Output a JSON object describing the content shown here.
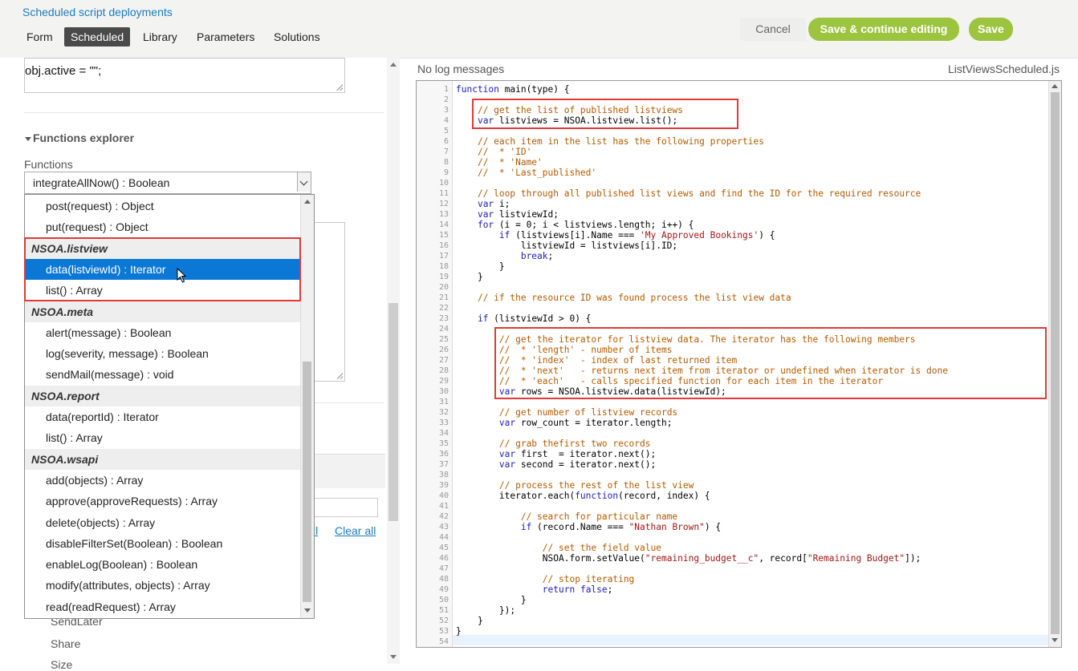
{
  "header": {
    "breadcrumb": "Scheduled script deployments",
    "tabs": [
      "Form",
      "Scheduled",
      "Library",
      "Parameters",
      "Solutions"
    ],
    "active_tab": "Scheduled",
    "cancel_label": "Cancel",
    "save_continue_label": "Save & continue editing",
    "save_label": "Save",
    "accent_color": "#9cc43f"
  },
  "left": {
    "code_snippet": "obj.active = \"\";",
    "functions_explorer_title": "Functions explorer",
    "functions_label": "Functions",
    "selected_function": "integrateAllNow() : Boolean",
    "dropdown": [
      {
        "type": "item",
        "label": "post(request) : Object"
      },
      {
        "type": "item",
        "label": "put(request) : Object"
      },
      {
        "type": "group",
        "label": "NSOA.listview"
      },
      {
        "type": "item",
        "label": "data(listviewId) : Iterator",
        "selected": true
      },
      {
        "type": "item",
        "label": "list() : Array"
      },
      {
        "type": "group",
        "label": "NSOA.meta"
      },
      {
        "type": "item",
        "label": "alert(message) : Boolean"
      },
      {
        "type": "item",
        "label": "log(severity, message) : Boolean"
      },
      {
        "type": "item",
        "label": "sendMail(message) : void"
      },
      {
        "type": "group",
        "label": "NSOA.report"
      },
      {
        "type": "item",
        "label": "data(reportId) : Iterator"
      },
      {
        "type": "item",
        "label": "list() : Array"
      },
      {
        "type": "group",
        "label": "NSOA.wsapi"
      },
      {
        "type": "item",
        "label": "add(objects) : Array"
      },
      {
        "type": "item",
        "label": "approve(approveRequests) : Array"
      },
      {
        "type": "item",
        "label": "delete(objects) : Array"
      },
      {
        "type": "item",
        "label": "disableFilterSet(Boolean) : Boolean"
      },
      {
        "type": "item",
        "label": "enableLog(Boolean) : Boolean"
      },
      {
        "type": "item",
        "label": "modify(attributes, objects) : Array"
      },
      {
        "type": "item",
        "label": "read(readRequest) : Array"
      }
    ],
    "behind": {
      "all_link": "ll",
      "clear_all_link": "Clear all",
      "send_later": "SendLater",
      "share": "Share",
      "size": "Size"
    }
  },
  "right": {
    "log_status": "No log messages",
    "file_name": "ListViewsScheduled.js",
    "code_lines": [
      "function main(type) {",
      "",
      "    // get the list of published listviews",
      "    var listviews = NSOA.listview.list();",
      "",
      "    // each item in the list has the following properties",
      "    //  * 'ID'",
      "    //  * 'Name'",
      "    //  * 'Last_published'",
      "",
      "    // loop through all published list views and find the ID for the required resource",
      "    var i;",
      "    var listviewId;",
      "    for (i = 0; i < listviews.length; i++) {",
      "        if (listviews[i].Name === 'My Approved Bookings') {",
      "            listviewId = listviews[i].ID;",
      "            break;",
      "        }",
      "    }",
      "",
      "    // if the resource ID was found process the list view data",
      "",
      "    if (listviewId > 0) {",
      "",
      "        // get the iterator for listview data. The iterator has the following members",
      "        //  * 'length' - number of items",
      "        //  * 'index'  - index of last returned item",
      "        //  * 'next'   - returns next item from iterator or undefined when iterator is done",
      "        //  * 'each'   - calls specified function for each item in the iterator",
      "        var rows = NSOA.listview.data(listviewId);",
      "",
      "        // get number of listview records",
      "        var row_count = iterator.length;",
      "",
      "        // grab thefirst two records",
      "        var first  = iterator.next();",
      "        var second = iterator.next();",
      "",
      "        // process the rest of the list view",
      "        iterator.each(function(record, index) {",
      "",
      "            // search for particular name",
      "            if (record.Name === \"Nathan Brown\") {",
      "",
      "                // set the field value",
      "                NSOA.form.setValue(\"remaining_budget__c\", record[\"Remaining Budget\"]);",
      "",
      "                // stop iterating",
      "                return false;",
      "            }",
      "        });",
      "    }",
      "}",
      ""
    ]
  }
}
